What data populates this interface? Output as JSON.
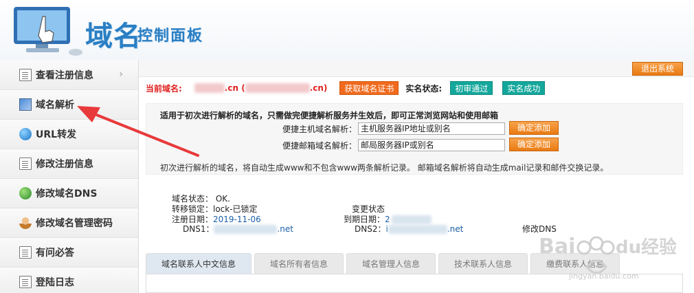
{
  "header": {
    "logo_main": "域名",
    "logo_sub": "控制面板"
  },
  "sidebar": {
    "items": [
      {
        "label": "查看注册信息",
        "icon": "document-icon",
        "chevron": "›"
      },
      {
        "label": "域名解析",
        "icon": "network-icon"
      },
      {
        "label": "URL转发",
        "icon": "globe-icon"
      },
      {
        "label": "修改注册信息",
        "icon": "document-edit-icon"
      },
      {
        "label": "修改域名DNS",
        "icon": "globe-dns-icon"
      },
      {
        "label": "修改域名管理密码",
        "icon": "user-icon"
      },
      {
        "label": "有问必答",
        "icon": "document-icon"
      },
      {
        "label": "登陆日志",
        "icon": "document-icon"
      }
    ]
  },
  "toolbar": {
    "logout_label": "退出系统"
  },
  "domain": {
    "label": "当前域名:",
    "suffix_1": ".cn (",
    "suffix_2": ".cn)",
    "cert_button": "获取域名证书",
    "real_name_label": "实名状态:",
    "badge_review": "初审通过",
    "badge_success": "实名成功"
  },
  "quick": {
    "intro": "适用于初次进行解析的域名，只需做完便捷解析服务并生效后，即可正常浏览网站和使用邮箱",
    "host_label": "便捷主机域名解析：",
    "host_value": "主机服务器IP地址或别名",
    "mail_label": "便捷邮箱域名解析：",
    "mail_value": "邮局服务器IP或别名",
    "add_button": "确定添加",
    "note": "初次进行解析的域名，将自动生成www和不包含www两条解析记录。 邮箱域名解析将自动生成mail记录和邮件交换记录。"
  },
  "status": {
    "domain_status": "域名状态： OK.",
    "transfer_lock": "转移锁定：lock-已锁定",
    "reg_date_label": "注册日期：",
    "reg_date_value": "2019-11-06",
    "change_status": "变更状态",
    "expire_label": "到期日期：",
    "expire_value": "2",
    "dns1_label": "DNS1：",
    "dns1_suffix": ".net",
    "dns2_label": "DNS2：",
    "dns2_prefix": "i",
    "dns2_suffix": ".net",
    "modify_dns": "修改DNS"
  },
  "tabs": [
    {
      "label": "域名联系人中文信息",
      "active": true
    },
    {
      "label": "域名所有者信息",
      "active": false
    },
    {
      "label": "域名管理人信息",
      "active": false
    },
    {
      "label": "技术联系人信息",
      "active": false
    },
    {
      "label": "缴费联系人信息",
      "active": false
    }
  ],
  "watermark": {
    "brand": "Bai du 经验",
    "url": "jingyan.baidu.com"
  },
  "colors": {
    "accent_blue": "#2a7fc4",
    "orange": "#f06a1e",
    "teal": "#14a79b",
    "red": "#e02020",
    "arrow": "#e8393b"
  }
}
